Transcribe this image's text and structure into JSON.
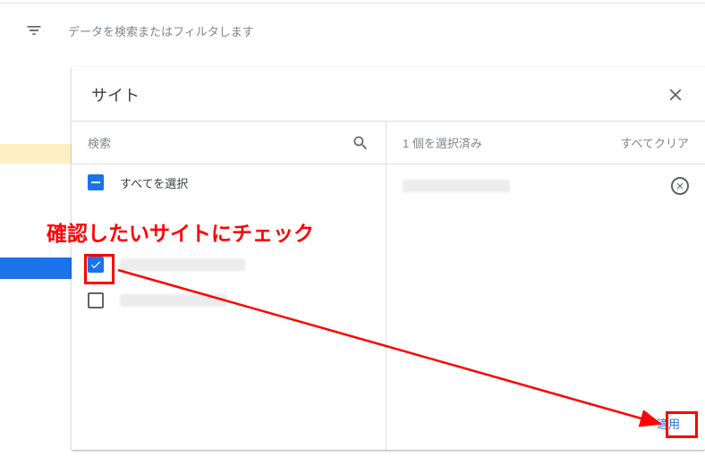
{
  "searchBar": {
    "placeholder": "データを検索またはフィルタします"
  },
  "modal": {
    "title": "サイト",
    "leftHeader": "検索",
    "selectAllLabel": "すべてを選択",
    "rightHeader": "1 個を選択済み",
    "clearAll": "すべてクリア",
    "apply": "適用"
  },
  "annotation": {
    "text": "確認したいサイトにチェック"
  }
}
